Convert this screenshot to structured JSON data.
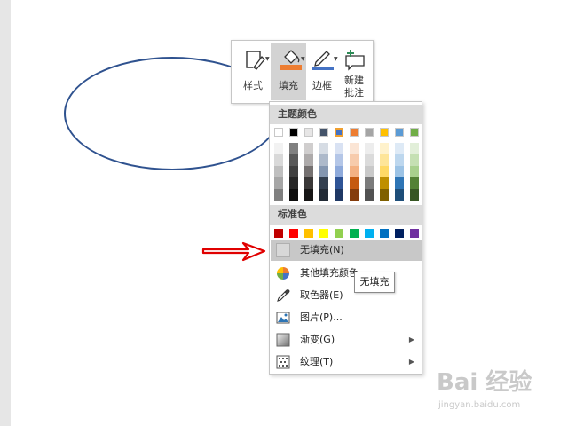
{
  "toolbar": {
    "style_label": "样式",
    "fill_label": "填充",
    "border_label": "边框",
    "new_comment_label_line1": "新建",
    "new_comment_label_line2": "批注"
  },
  "fill_menu": {
    "theme_colors_header": "主题颜色",
    "theme_colors_top": [
      "#ffffff",
      "#000000",
      "#e7e6e6",
      "#44546a",
      "#4472c4",
      "#ed7d31",
      "#a5a5a5",
      "#ffc000",
      "#5b9bd5",
      "#70ad47"
    ],
    "theme_shades": [
      [
        "#f2f2f2",
        "#d9d9d9",
        "#bfbfbf",
        "#a6a6a6",
        "#808080"
      ],
      [
        "#808080",
        "#595959",
        "#404040",
        "#262626",
        "#0d0d0d"
      ],
      [
        "#d0cece",
        "#aeabab",
        "#757171",
        "#3a3838",
        "#171616"
      ],
      [
        "#d6dce4",
        "#adb9ca",
        "#8496b0",
        "#333f4f",
        "#222a35"
      ],
      [
        "#d9e2f3",
        "#b4c6e7",
        "#8eaadb",
        "#2f5496",
        "#1f3864"
      ],
      [
        "#fbe5d5",
        "#f7cbac",
        "#f4b183",
        "#c55a11",
        "#843c0c"
      ],
      [
        "#ededed",
        "#dbdbdb",
        "#c9c9c9",
        "#7b7b7b",
        "#525252"
      ],
      [
        "#fff2cc",
        "#fee599",
        "#ffd965",
        "#bf8f00",
        "#7f6000"
      ],
      [
        "#deeaf6",
        "#bdd7ee",
        "#9cc3e5",
        "#2e75b5",
        "#1e4e79"
      ],
      [
        "#e2efd9",
        "#c5e0b3",
        "#a8d08d",
        "#538135",
        "#375623"
      ]
    ],
    "standard_colors_header": "标准色",
    "standard_colors": [
      "#c00000",
      "#ff0000",
      "#ffc000",
      "#ffff00",
      "#92d050",
      "#00b050",
      "#00b0f0",
      "#0070c0",
      "#002060",
      "#7030a0"
    ],
    "no_fill_label": "无填充(N)",
    "more_colors_label": "其他填充颜色",
    "eyedropper_label": "取色器(E)",
    "picture_label": "图片(P)...",
    "gradient_label": "渐变(G)",
    "texture_label": "纹理(T)"
  },
  "tooltip_text": "无填充",
  "watermark": {
    "brand": "Bai 经验",
    "url": "jingyan.baidu.com"
  },
  "colors": {
    "shape_outline": "#2f528f",
    "arrow": "#e00000",
    "fill_bucket_bar": "#ed7d31",
    "border_pen_bar": "#4472c4",
    "selected_swatch_border": "#f0a030"
  },
  "icons": [
    "shape-style-icon",
    "fill-bucket-icon",
    "border-pen-icon",
    "new-comment-icon",
    "no-fill-icon",
    "color-wheel-icon",
    "eyedropper-icon",
    "picture-icon",
    "gradient-icon",
    "texture-icon",
    "chevron-right-icon"
  ]
}
